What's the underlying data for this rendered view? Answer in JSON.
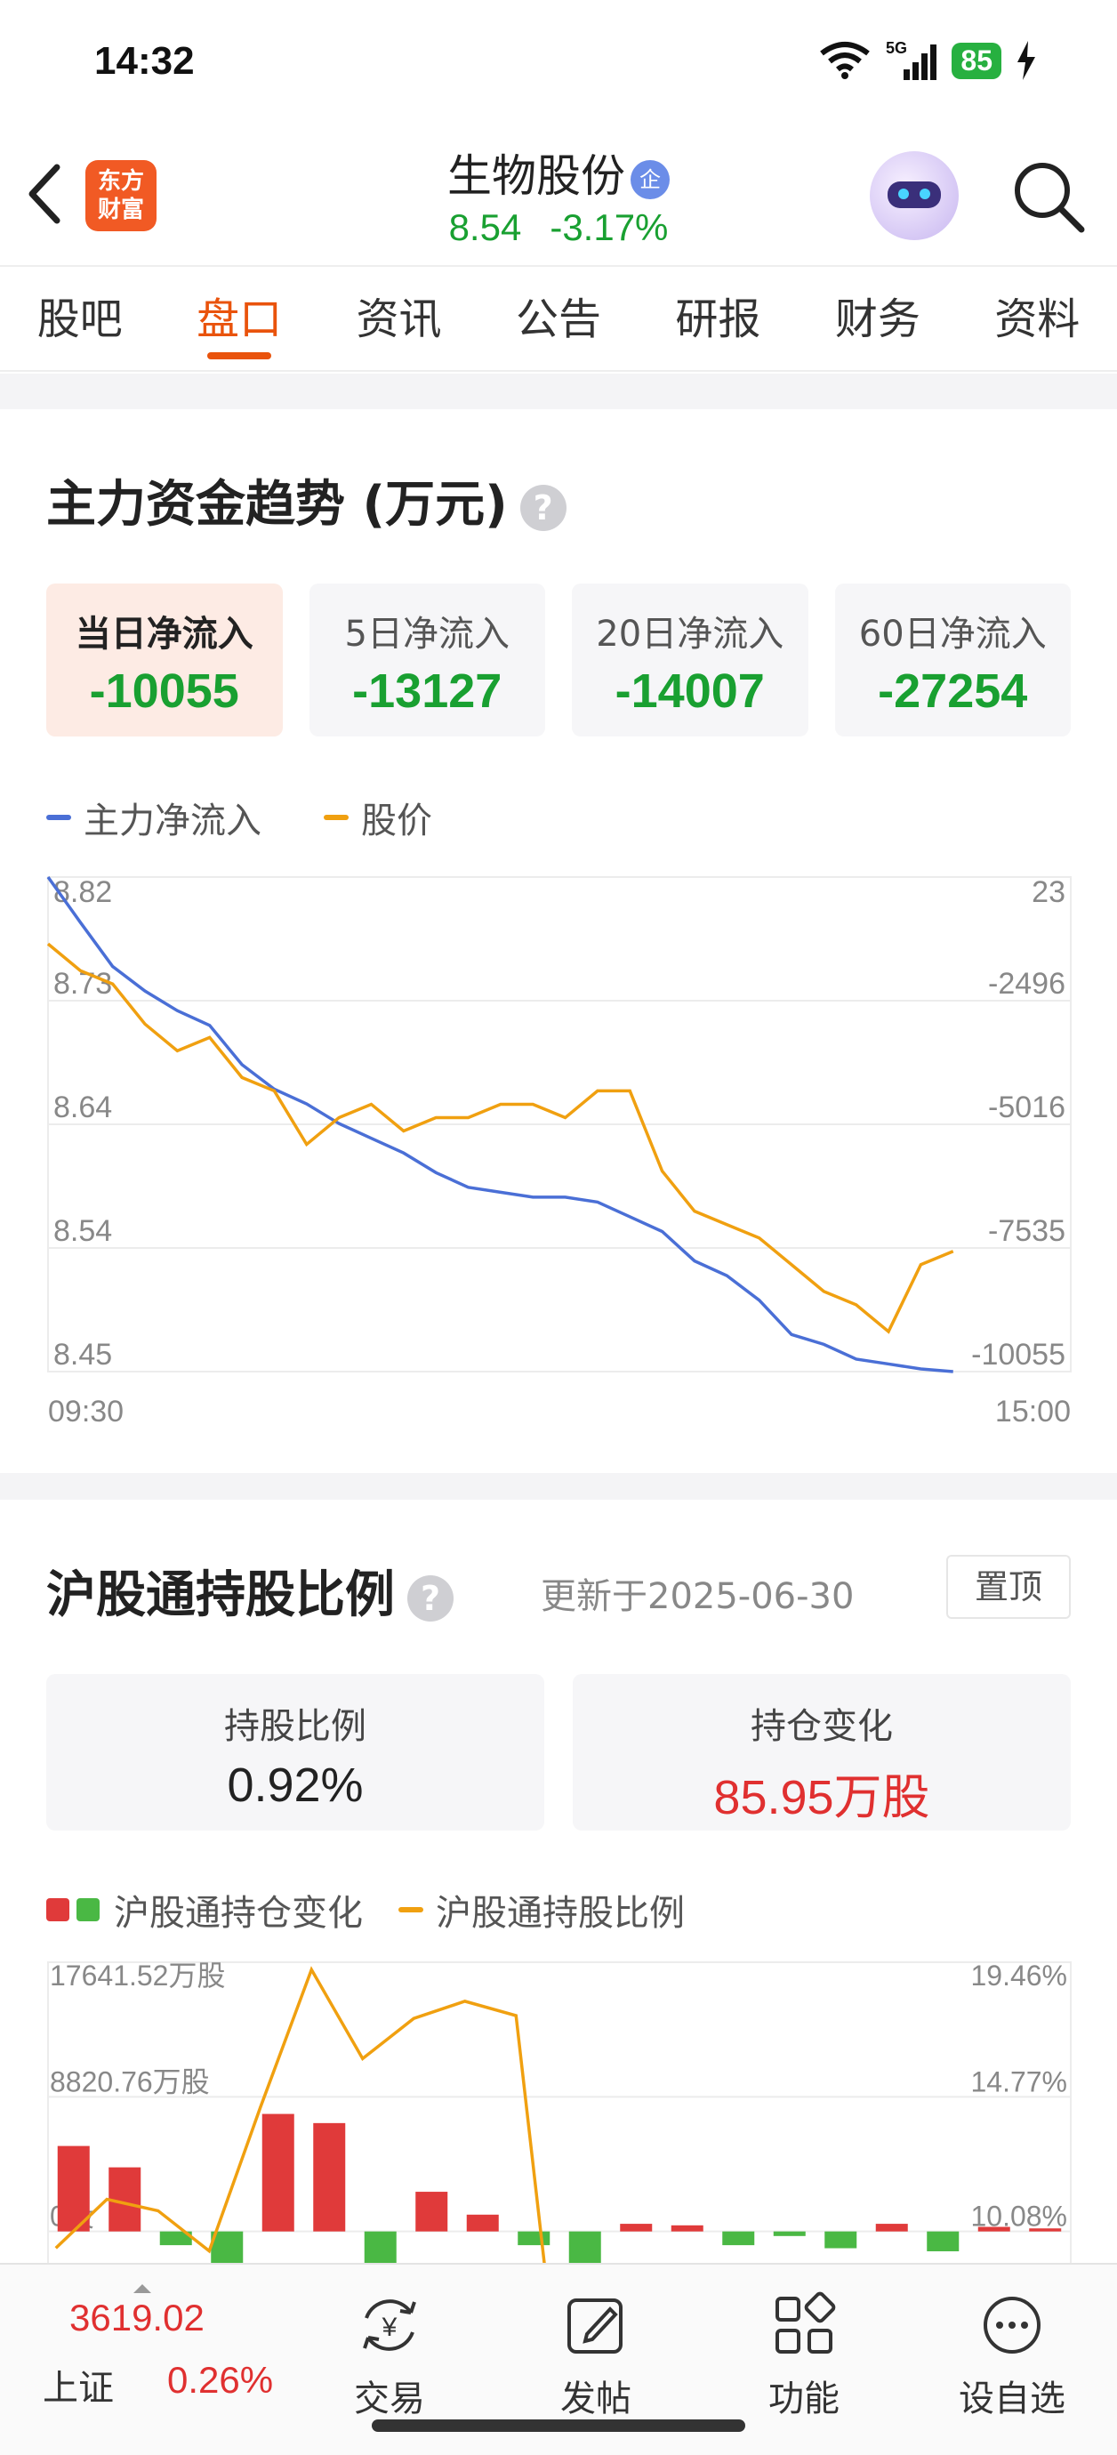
{
  "status_bar": {
    "time": "14:32",
    "network": "5G",
    "battery": "85"
  },
  "header": {
    "logo": "东方财富",
    "stock_name": "生物股份",
    "badge": "企",
    "price": "8.54",
    "change_pct": "-3.17%"
  },
  "tabs": [
    {
      "label": "股吧"
    },
    {
      "label": "盘口"
    },
    {
      "label": "资讯"
    },
    {
      "label": "公告"
    },
    {
      "label": "研报"
    },
    {
      "label": "财务"
    },
    {
      "label": "资料"
    }
  ],
  "active_tab": "盘口",
  "fund_flow": {
    "title": "主力资金趋势 (万元)",
    "help": "?",
    "cards": [
      {
        "label": "当日净流入",
        "value": "-10055"
      },
      {
        "label": "5日净流入",
        "value": "-13127"
      },
      {
        "label": "20日净流入",
        "value": "-14007"
      },
      {
        "label": "60日净流入",
        "value": "-27254"
      }
    ],
    "legend": {
      "main_flow": "主力净流入",
      "price": "股价"
    }
  },
  "hk_connect": {
    "title": "沪股通持股比例",
    "help": "?",
    "updated": "更新于2025-06-30",
    "pin_button": "置顶",
    "cards": [
      {
        "label": "持股比例",
        "value": "0.92%"
      },
      {
        "label": "持仓变化",
        "value": "85.95万股"
      }
    ],
    "legend": {
      "change": "沪股通持仓变化",
      "ratio": "沪股通持股比例"
    }
  },
  "bottom_bar": {
    "index_value": "3619.02",
    "index_name": "上证",
    "index_pct": "0.26%",
    "buttons": [
      {
        "label": "交易"
      },
      {
        "label": "发帖"
      },
      {
        "label": "功能"
      },
      {
        "label": "设自选"
      }
    ]
  },
  "colors": {
    "accent": "#e9530c",
    "down_green": "#19a031",
    "up_red": "#e03030",
    "flow_line": "#4a6fd6",
    "price_line": "#f0a010"
  },
  "chart_data": [
    {
      "type": "line",
      "title": "主力资金趋势 (万元)",
      "x_labels": [
        "09:30",
        "15:00"
      ],
      "left_axis_ticks": [
        "8.82",
        "8.73",
        "8.64",
        "8.54",
        "8.45"
      ],
      "right_axis_ticks": [
        "23",
        "-2496",
        "-5016",
        "-7535",
        "-10055"
      ],
      "ylim_left": [
        8.45,
        8.82
      ],
      "ylim_right": [
        -10055,
        23
      ],
      "series": [
        {
          "name": "主力净流入",
          "axis": "right",
          "values": [
            23,
            -900,
            -1800,
            -2300,
            -2700,
            -3000,
            -3800,
            -4300,
            -4600,
            -5000,
            -5300,
            -5600,
            -6000,
            -6300,
            -6400,
            -6500,
            -6500,
            -6600,
            -6900,
            -7200,
            -7800,
            -8100,
            -8600,
            -9300,
            -9500,
            -9800,
            -9900,
            -10000,
            -10055
          ]
        },
        {
          "name": "股价",
          "axis": "left",
          "values": [
            8.77,
            8.75,
            8.74,
            8.71,
            8.69,
            8.7,
            8.67,
            8.66,
            8.62,
            8.64,
            8.65,
            8.63,
            8.64,
            8.64,
            8.65,
            8.65,
            8.64,
            8.66,
            8.66,
            8.6,
            8.57,
            8.56,
            8.55,
            8.53,
            8.51,
            8.5,
            8.48,
            8.53,
            8.54
          ]
        }
      ]
    },
    {
      "type": "bar",
      "title": "沪股通持股比例",
      "left_axis_ticks": [
        "17641.52万股",
        "8820.76万股",
        "0股"
      ],
      "right_axis_ticks": [
        "19.46%",
        "14.77%",
        "10.08%"
      ],
      "ylim_left": [
        -8820.76,
        17641.52
      ],
      "ylim_right": [
        5.39,
        19.46
      ],
      "series": [
        {
          "name": "沪股通持仓变化",
          "axis": "left",
          "values": [
            5600,
            4200,
            -900,
            -2400,
            7700,
            7100,
            -5400,
            2600,
            1100,
            -900,
            -5300,
            500,
            400,
            -900,
            -300,
            -1100,
            500,
            -1300,
            300,
            200
          ]
        },
        {
          "name": "沪股通持股比例",
          "axis": "right",
          "values": [
            9.5,
            11.2,
            10.8,
            9.4,
            14.4,
            19.2,
            16.1,
            17.5,
            18.1,
            17.6,
            2.0
          ]
        }
      ]
    }
  ]
}
